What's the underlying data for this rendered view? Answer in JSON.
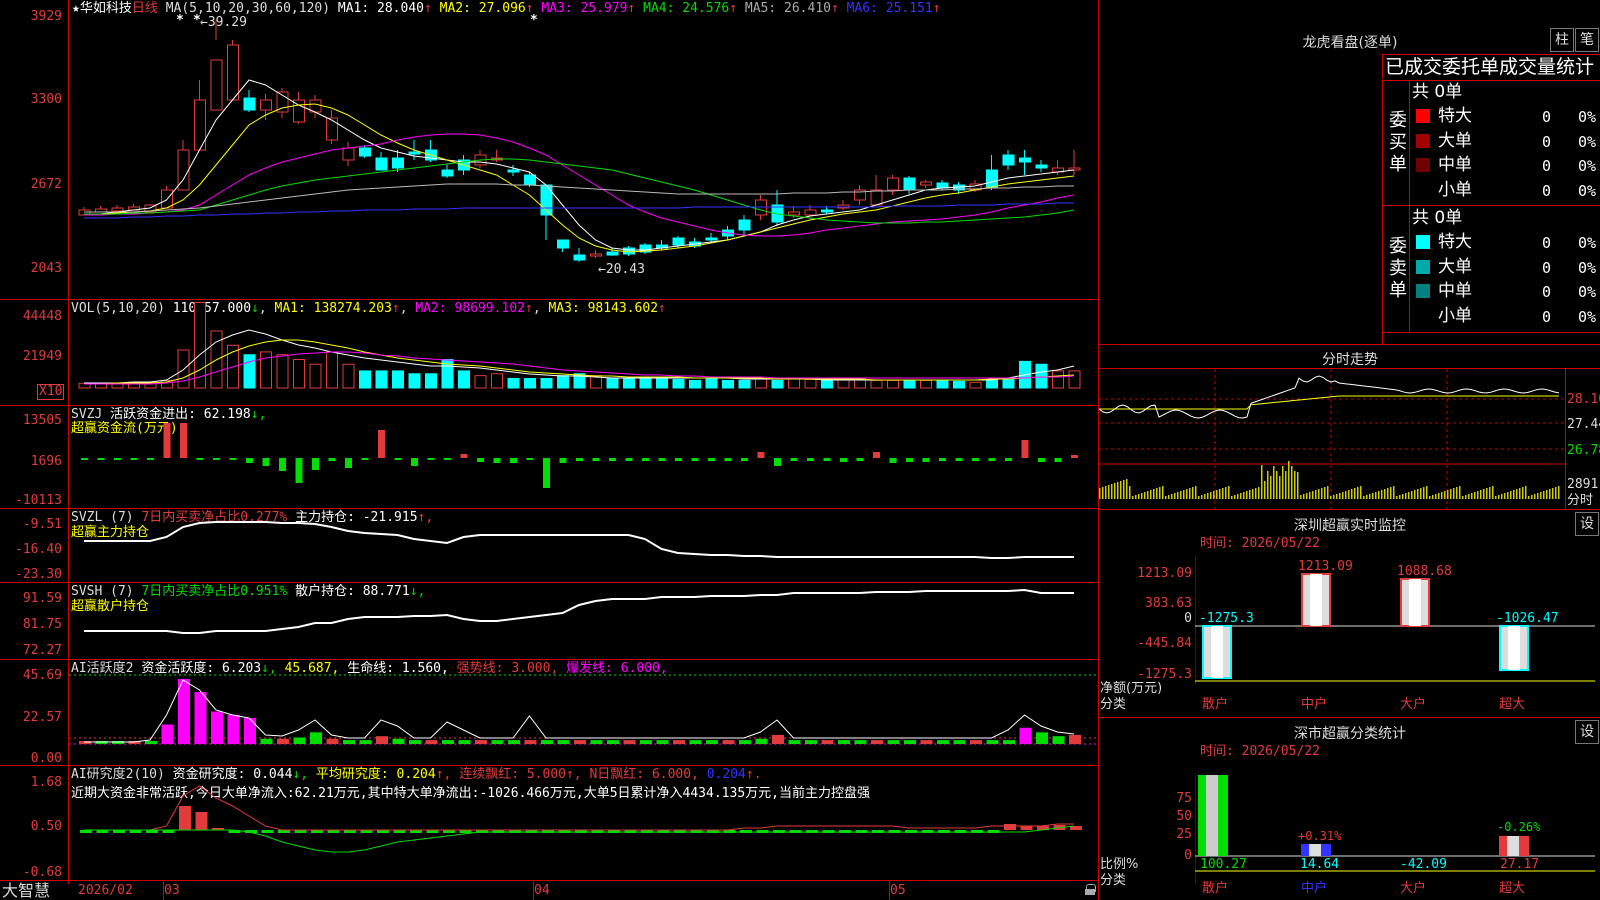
{
  "stock": {
    "star": "★",
    "name": "华如科技",
    "period": "日线",
    "ma_label": "MA(5,10,20,30,60,120)",
    "ma": [
      {
        "label": "MA1:",
        "value": "28.040",
        "arrow": "↑",
        "color": "#ffffff"
      },
      {
        "label": "MA2:",
        "value": "27.096",
        "arrow": "↑",
        "color": "#ffff00"
      },
      {
        "label": "MA3:",
        "value": "25.979",
        "arrow": "↑",
        "color": "#ff00ff"
      },
      {
        "label": "MA4:",
        "value": "24.576",
        "arrow": "↑",
        "color": "#00dd00"
      },
      {
        "label": "MA5:",
        "value": "26.410",
        "arrow": "↑",
        "color": "#aaaaaa"
      },
      {
        "label": "MA6:",
        "value": "25.151",
        "arrow": "↑",
        "color": "#3333ff"
      }
    ],
    "price_axis": [
      "3929",
      "3300",
      "2672",
      "2043"
    ],
    "high_label": "39.29",
    "low_label": "20.43",
    "markers": [
      "*",
      "*",
      "*"
    ]
  },
  "vol": {
    "title": "VOL(5,10,20)",
    "value": "110957.000",
    "value_arrow": "↓",
    "ma1": "MA1: 138274.203",
    "ma2": "MA2: 98699.102",
    "ma3": "MA3: 98143.602",
    "axis": [
      "44448",
      "21949"
    ],
    "unit": "X10"
  },
  "svzj": {
    "title": "SVZJ",
    "label": "活跃资金进出: 62.198",
    "arrow": "↓,",
    "subtitle": "超赢资金流(万元)",
    "axis": [
      "13505",
      "1696",
      "-10113"
    ]
  },
  "svzl": {
    "title": "SVZL (7)",
    "desc": "7日内买卖净占比0.277%",
    "label": "主力持仓: -21.915",
    "arrow": "↑,",
    "subtitle": "超赢主力持仓",
    "axis": [
      "-9.51",
      "-16.40",
      "-23.30"
    ]
  },
  "svsh": {
    "title": "SVSH (7)",
    "desc": "7日内买卖净占比0.951%",
    "label": "散户持仓: 88.771",
    "arrow": "↓,",
    "subtitle": "超赢散户持仓",
    "axis": [
      "91.59",
      "81.75",
      "72.27"
    ]
  },
  "ai_active": {
    "title": "AI活跃度2",
    "label1": "资金活跃度: 6.203",
    "arrow1": "↓,",
    "value2": "45.687,",
    "label3": "生命线: 1.560,",
    "label4": "强势线: 3.000,",
    "label5": "爆发线: 6.000,",
    "axis": [
      "45.69",
      "22.57",
      "0.00"
    ]
  },
  "ai_research": {
    "title": "AI研究度2(10)",
    "label1": "资金研究度: 0.044",
    "arrow1": "↓,",
    "label2": "平均研究度: 0.204",
    "arrow2": "↑,",
    "label3": "连续飘红: 5.000",
    "arrow3": "↑,",
    "label4": "N日飘红: 6.000,",
    "label5": "0.204",
    "arrow5": "↑.",
    "comment": "近期大资金非常活跃,今日大单净流入:62.21万元,其中特大单净流出:-1026.466万元,大单5日累计净入4434.135万元,当前主力控盘强",
    "axis": [
      "1.68",
      "0.50",
      "-0.68"
    ]
  },
  "date_axis": {
    "brand": "大智慧",
    "labels": [
      "2026/02",
      "03",
      "04",
      "05"
    ]
  },
  "dragon": {
    "title": "龙虎看盘(逐单)",
    "btn1": "柱",
    "btn2": "笔",
    "header": "已成交委托单成交量统计",
    "buy": {
      "side": "委买单",
      "total": "共 0单",
      "rows": [
        {
          "label": "特大",
          "count": "0",
          "pct": "0%",
          "color": "#ff0000"
        },
        {
          "label": "大单",
          "count": "0",
          "pct": "0%",
          "color": "#a00000"
        },
        {
          "label": "中单",
          "count": "0",
          "pct": "0%",
          "color": "#700000"
        },
        {
          "label": "小单",
          "count": "0",
          "pct": "0%",
          "color": "#000000"
        }
      ]
    },
    "sell": {
      "side": "委卖单",
      "total": "共 0单",
      "rows": [
        {
          "label": "特大",
          "count": "0",
          "pct": "0%",
          "color": "#00ffff"
        },
        {
          "label": "大单",
          "count": "0",
          "pct": "0%",
          "color": "#00aaaa"
        },
        {
          "label": "中单",
          "count": "0",
          "pct": "0%",
          "color": "#008080"
        },
        {
          "label": "小单",
          "count": "0",
          "pct": "0%",
          "color": "#000000"
        }
      ]
    }
  },
  "intraday": {
    "title": "分时走势",
    "price_axis": [
      "28.10",
      "27.44",
      "26.78"
    ],
    "vol_axis": "2891",
    "unit": "分时"
  },
  "sz_monitor": {
    "title": "深圳超赢实时监控",
    "settings": "设",
    "time": "时间: 2026/05/22",
    "axis": [
      "1213.09",
      "383.63",
      "0",
      "-445.84",
      "-1275.3"
    ],
    "ylabel": "净额(万元)",
    "xlabel": "分类",
    "categories": [
      "散户",
      "中户",
      "大户",
      "超大"
    ],
    "values": [
      "-1275.3",
      "1213.09",
      "1088.68",
      "-1026.47"
    ]
  },
  "sz_stats": {
    "title": "深市超赢分类统计",
    "settings": "设",
    "time": "时间: 2026/05/22",
    "axis": [
      "75",
      "50",
      "25",
      "0"
    ],
    "ylabel": "比例%",
    "xlabel": "分类",
    "categories": [
      "散户",
      "中户",
      "大户",
      "超大"
    ],
    "values": [
      "100.27",
      "14.64",
      "-42.09",
      "27.17"
    ],
    "pct_labels": [
      "+0.31%",
      "-0.26%"
    ]
  }
}
